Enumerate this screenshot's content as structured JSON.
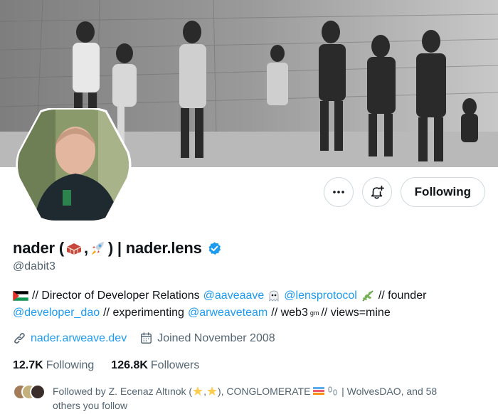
{
  "profile": {
    "display_name": "nader (",
    "display_name_mid": ", ",
    "display_name_end": ") | nader.lens",
    "handle": "@dabit3",
    "verified": true
  },
  "actions": {
    "more_icon": "more-icon",
    "notify_icon": "notification-bell-plus-icon",
    "follow_label": "Following"
  },
  "bio": {
    "line1_prefix": "// Director of Developer Relations",
    "mention_aave": "@aaveaave",
    "mention_lens": "@lensprotocol",
    "line1_suffix": "// founder",
    "mention_devdao": "@developer_dao",
    "line2_mid": "// experimenting",
    "mention_arweave": "@arweaveteam",
    "line2_web3": "// web3",
    "line2_sup": "gm",
    "line2_end": "// views=mine"
  },
  "meta": {
    "website": "nader.arweave.dev",
    "joined": "Joined November 2008"
  },
  "stats": {
    "following_count": "12.7K",
    "following_label": "Following",
    "followers_count": "126.8K",
    "followers_label": "Followers"
  },
  "followed_by": {
    "text_a": "Followed by Z. Ecenaz Altınok (",
    "text_b": ",",
    "text_c": "), CONGLOMERATE",
    "text_d": "| WolvesDAO, and 58",
    "text_e": "others you follow"
  },
  "colors": {
    "accent": "#1d9bf0",
    "text": "#0f1419",
    "muted": "#536471",
    "border": "#cfd9de"
  }
}
